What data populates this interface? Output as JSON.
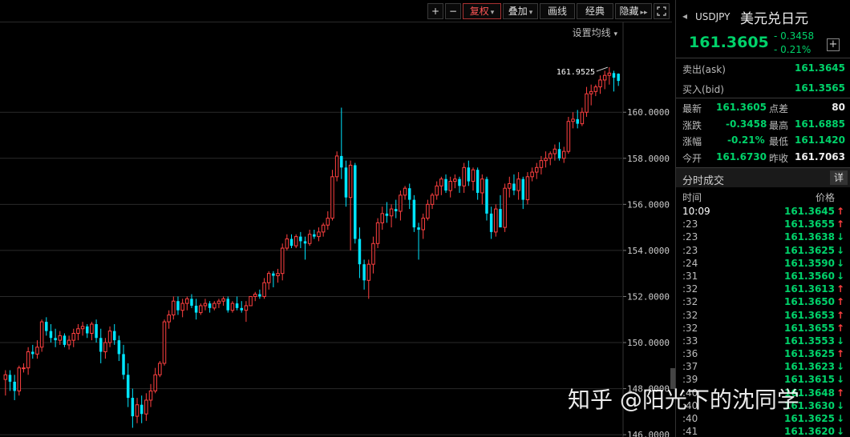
{
  "toolbar": {
    "zoom_in": "+",
    "zoom_out": "−",
    "restore_rights": "复权",
    "overlay": "叠加",
    "draw": "画线",
    "classic": "经典",
    "hide": "隐藏",
    "hide_icon": "double-right-arrow-icon",
    "fullscreen_icon": "fullscreen-icon",
    "ma_setting": "设置均线"
  },
  "colors": {
    "up": "#ff4040",
    "down": "#00e5ff",
    "quote_green": "#00d26a",
    "background": "#000000",
    "grid": "#2a2a2a"
  },
  "chart_data": {
    "type": "candlestick",
    "y_ticks": [
      "160.0000",
      "158.0000",
      "156.0000",
      "154.0000",
      "152.0000",
      "150.0000",
      "148.0000",
      "146.0000"
    ],
    "ylim": [
      145.9,
      163.9
    ],
    "high_marker": "161.9525",
    "candles": [
      [
        148.4,
        148.8,
        147.7,
        148.6
      ],
      [
        148.6,
        148.8,
        147.9,
        148.3
      ],
      [
        148.3,
        148.6,
        147.5,
        147.9
      ],
      [
        147.9,
        149.0,
        147.7,
        148.9
      ],
      [
        148.9,
        149.1,
        148.7,
        148.9
      ],
      [
        148.9,
        149.8,
        148.6,
        149.6
      ],
      [
        149.6,
        149.9,
        149.3,
        149.5
      ],
      [
        149.5,
        150.1,
        149.3,
        149.8
      ],
      [
        149.8,
        151.0,
        149.6,
        150.9
      ],
      [
        150.9,
        151.1,
        150.3,
        150.5
      ],
      [
        150.5,
        150.8,
        150.0,
        150.2
      ],
      [
        150.2,
        150.6,
        149.8,
        150.1
      ],
      [
        150.1,
        150.5,
        149.9,
        150.3
      ],
      [
        150.3,
        150.4,
        149.8,
        149.9
      ],
      [
        149.9,
        150.3,
        149.7,
        150.1
      ],
      [
        150.1,
        150.6,
        149.8,
        150.4
      ],
      [
        150.4,
        150.8,
        150.1,
        150.6
      ],
      [
        150.6,
        150.9,
        150.3,
        150.7
      ],
      [
        150.7,
        150.8,
        150.2,
        150.4
      ],
      [
        150.4,
        150.9,
        150.1,
        150.8
      ],
      [
        150.8,
        151.0,
        150.0,
        150.2
      ],
      [
        150.2,
        150.6,
        149.1,
        149.6
      ],
      [
        149.6,
        150.2,
        149.3,
        150.0
      ],
      [
        150.0,
        150.7,
        149.8,
        150.5
      ],
      [
        150.5,
        150.8,
        149.9,
        150.1
      ],
      [
        150.1,
        150.3,
        149.2,
        149.5
      ],
      [
        149.5,
        149.9,
        148.4,
        148.6
      ],
      [
        148.6,
        149.1,
        147.2,
        147.6
      ],
      [
        147.6,
        148.0,
        146.3,
        146.8
      ],
      [
        146.8,
        147.6,
        146.5,
        147.3
      ],
      [
        147.3,
        147.7,
        146.5,
        146.9
      ],
      [
        146.9,
        147.8,
        146.6,
        147.5
      ],
      [
        147.5,
        148.2,
        147.2,
        147.9
      ],
      [
        147.9,
        148.9,
        147.8,
        148.6
      ],
      [
        148.6,
        149.2,
        148.5,
        149.1
      ],
      [
        149.1,
        151.0,
        149.0,
        150.9
      ],
      [
        150.9,
        151.4,
        150.6,
        151.2
      ],
      [
        151.2,
        152.0,
        151.0,
        151.8
      ],
      [
        151.8,
        152.0,
        151.2,
        151.4
      ],
      [
        151.4,
        151.9,
        151.1,
        151.7
      ],
      [
        151.7,
        152.0,
        151.4,
        151.9
      ],
      [
        151.9,
        152.1,
        151.5,
        151.6
      ],
      [
        151.6,
        151.9,
        151.0,
        151.3
      ],
      [
        151.3,
        151.7,
        151.2,
        151.6
      ],
      [
        151.6,
        151.9,
        151.4,
        151.7
      ],
      [
        151.7,
        151.8,
        151.3,
        151.5
      ],
      [
        151.5,
        151.8,
        151.4,
        151.7
      ],
      [
        151.7,
        151.9,
        151.5,
        151.8
      ],
      [
        151.8,
        152.0,
        151.6,
        151.9
      ],
      [
        151.9,
        152.0,
        151.3,
        151.4
      ],
      [
        151.4,
        151.8,
        151.3,
        151.7
      ],
      [
        151.7,
        152.0,
        151.4,
        151.5
      ],
      [
        151.5,
        151.8,
        151.3,
        151.4
      ],
      [
        151.4,
        151.8,
        150.9,
        151.6
      ],
      [
        151.6,
        152.0,
        151.6,
        152.0
      ],
      [
        152.0,
        152.2,
        151.8,
        152.1
      ],
      [
        152.1,
        152.3,
        151.9,
        152.0
      ],
      [
        152.0,
        152.8,
        151.9,
        152.6
      ],
      [
        152.6,
        153.1,
        152.3,
        153.0
      ],
      [
        153.0,
        153.1,
        152.4,
        152.9
      ],
      [
        152.9,
        153.2,
        152.6,
        153.0
      ],
      [
        153.0,
        154.3,
        152.7,
        154.1
      ],
      [
        154.1,
        154.7,
        154.0,
        154.5
      ],
      [
        154.5,
        154.7,
        154.1,
        154.2
      ],
      [
        154.2,
        154.7,
        154.1,
        154.6
      ],
      [
        154.6,
        154.8,
        154.1,
        154.4
      ],
      [
        154.4,
        154.6,
        153.6,
        154.3
      ],
      [
        154.3,
        154.9,
        154.2,
        154.7
      ],
      [
        154.7,
        154.9,
        154.5,
        154.6
      ],
      [
        154.6,
        155.0,
        154.4,
        154.8
      ],
      [
        154.8,
        155.2,
        154.6,
        155.1
      ],
      [
        155.1,
        155.7,
        154.9,
        155.4
      ],
      [
        155.4,
        157.5,
        155.3,
        157.2
      ],
      [
        157.2,
        158.3,
        157.0,
        158.1
      ],
      [
        158.1,
        160.2,
        157.1,
        157.6
      ],
      [
        157.6,
        157.9,
        155.9,
        156.3
      ],
      [
        156.3,
        157.9,
        154.0,
        157.7
      ],
      [
        157.7,
        157.8,
        154.3,
        154.5
      ],
      [
        154.5,
        155.0,
        152.8,
        153.4
      ],
      [
        153.4,
        153.6,
        152.3,
        152.7
      ],
      [
        152.7,
        153.6,
        151.9,
        153.4
      ],
      [
        153.4,
        154.6,
        153.0,
        154.3
      ],
      [
        154.3,
        155.4,
        154.1,
        155.2
      ],
      [
        155.2,
        155.9,
        154.9,
        155.6
      ],
      [
        155.6,
        156.1,
        155.2,
        155.5
      ],
      [
        155.5,
        156.0,
        155.0,
        155.8
      ],
      [
        155.8,
        156.2,
        155.4,
        155.7
      ],
      [
        155.7,
        156.6,
        155.3,
        156.4
      ],
      [
        156.4,
        156.8,
        156.2,
        156.7
      ],
      [
        156.7,
        156.9,
        155.8,
        156.2
      ],
      [
        156.2,
        156.4,
        154.8,
        155.0
      ],
      [
        155.0,
        155.2,
        153.6,
        154.9
      ],
      [
        154.9,
        155.6,
        154.5,
        155.4
      ],
      [
        155.4,
        156.2,
        155.3,
        156.0
      ],
      [
        156.0,
        156.5,
        155.8,
        156.4
      ],
      [
        156.4,
        157.0,
        156.2,
        156.8
      ],
      [
        156.8,
        157.2,
        156.4,
        157.1
      ],
      [
        157.1,
        157.3,
        156.5,
        156.6
      ],
      [
        156.6,
        157.2,
        156.3,
        157.0
      ],
      [
        157.0,
        157.3,
        156.7,
        157.1
      ],
      [
        157.1,
        157.2,
        156.5,
        156.8
      ],
      [
        156.8,
        157.8,
        156.5,
        157.6
      ],
      [
        157.6,
        157.9,
        156.8,
        157.0
      ],
      [
        157.0,
        157.6,
        156.6,
        157.5
      ],
      [
        157.5,
        157.6,
        156.2,
        156.5
      ],
      [
        156.5,
        157.3,
        156.0,
        157.1
      ],
      [
        157.1,
        157.2,
        155.3,
        155.6
      ],
      [
        155.6,
        155.9,
        154.5,
        154.8
      ],
      [
        154.8,
        156.0,
        154.6,
        155.8
      ],
      [
        155.8,
        156.4,
        155.3,
        155.0
      ],
      [
        155.0,
        156.9,
        154.8,
        156.7
      ],
      [
        156.7,
        157.2,
        156.3,
        156.9
      ],
      [
        156.9,
        157.3,
        156.4,
        156.6
      ],
      [
        156.6,
        157.4,
        156.2,
        157.1
      ],
      [
        157.1,
        157.2,
        155.8,
        156.2
      ],
      [
        156.2,
        157.4,
        156.0,
        157.2
      ],
      [
        157.2,
        157.6,
        157.0,
        157.4
      ],
      [
        157.4,
        157.8,
        157.1,
        157.6
      ],
      [
        157.6,
        158.1,
        157.3,
        157.9
      ],
      [
        157.9,
        158.3,
        157.6,
        158.0
      ],
      [
        158.0,
        158.3,
        157.7,
        158.2
      ],
      [
        158.2,
        158.6,
        157.9,
        158.4
      ],
      [
        158.4,
        158.7,
        157.9,
        158.0
      ],
      [
        158.0,
        158.5,
        157.8,
        158.3
      ],
      [
        158.3,
        159.8,
        158.2,
        159.6
      ],
      [
        159.6,
        160.0,
        159.3,
        159.7
      ],
      [
        159.7,
        160.1,
        159.3,
        159.5
      ],
      [
        159.5,
        160.2,
        159.4,
        160.0
      ],
      [
        160.0,
        161.1,
        159.8,
        160.8
      ],
      [
        160.8,
        161.2,
        160.3,
        160.9
      ],
      [
        160.9,
        161.2,
        160.7,
        161.1
      ],
      [
        161.1,
        161.6,
        160.8,
        161.4
      ],
      [
        161.4,
        161.8,
        161.0,
        161.6
      ],
      [
        161.6,
        161.9525,
        161.2,
        161.7
      ],
      [
        161.7,
        161.8,
        160.9,
        161.5
      ],
      [
        161.673,
        161.6885,
        161.142,
        161.3605
      ]
    ]
  },
  "quote": {
    "symbol": "USDJPY",
    "name": "美元兑日元",
    "last": "161.3605",
    "change": "- 0.3458",
    "change_pct": "- 0.21%",
    "ask_label": "卖出(ask)",
    "ask": "161.3645",
    "bid_label": "买入(bid)",
    "bid": "161.3565",
    "latest_label": "最新",
    "latest": "161.3605",
    "spread_label": "点差",
    "spread": "80",
    "chg_label": "涨跌",
    "chg": "-0.3458",
    "high_label": "最高",
    "high": "161.6885",
    "pct_label": "涨幅",
    "pct": "-0.21%",
    "low_label": "最低",
    "low": "161.1420",
    "open_label": "今开",
    "open": "161.6730",
    "prev_label": "昨收",
    "prev": "161.7063"
  },
  "ticks": {
    "title": "分时成交",
    "detail": "详",
    "time_header": "时间",
    "price_header": "价格",
    "rows": [
      {
        "t": "10:09",
        "p": "161.3645",
        "dir": "up"
      },
      {
        "t": ":23",
        "p": "161.3655",
        "dir": "up"
      },
      {
        "t": ":23",
        "p": "161.3638",
        "dir": "down"
      },
      {
        "t": ":23",
        "p": "161.3625",
        "dir": "down"
      },
      {
        "t": ":24",
        "p": "161.3590",
        "dir": "down"
      },
      {
        "t": ":31",
        "p": "161.3560",
        "dir": "down"
      },
      {
        "t": ":32",
        "p": "161.3613",
        "dir": "up"
      },
      {
        "t": ":32",
        "p": "161.3650",
        "dir": "up"
      },
      {
        "t": ":32",
        "p": "161.3653",
        "dir": "up"
      },
      {
        "t": ":32",
        "p": "161.3655",
        "dir": "up"
      },
      {
        "t": ":33",
        "p": "161.3553",
        "dir": "down"
      },
      {
        "t": ":36",
        "p": "161.3625",
        "dir": "up"
      },
      {
        "t": ":37",
        "p": "161.3623",
        "dir": "down"
      },
      {
        "t": ":39",
        "p": "161.3615",
        "dir": "down"
      },
      {
        "t": ":40",
        "p": "161.3648",
        "dir": "up"
      },
      {
        "t": ":40",
        "p": "161.3630",
        "dir": "down"
      },
      {
        "t": ":40",
        "p": "161.3625",
        "dir": "down"
      },
      {
        "t": ":41",
        "p": "161.3620",
        "dir": "down"
      }
    ]
  },
  "watermark": "知乎 @阳光下的沈同学"
}
